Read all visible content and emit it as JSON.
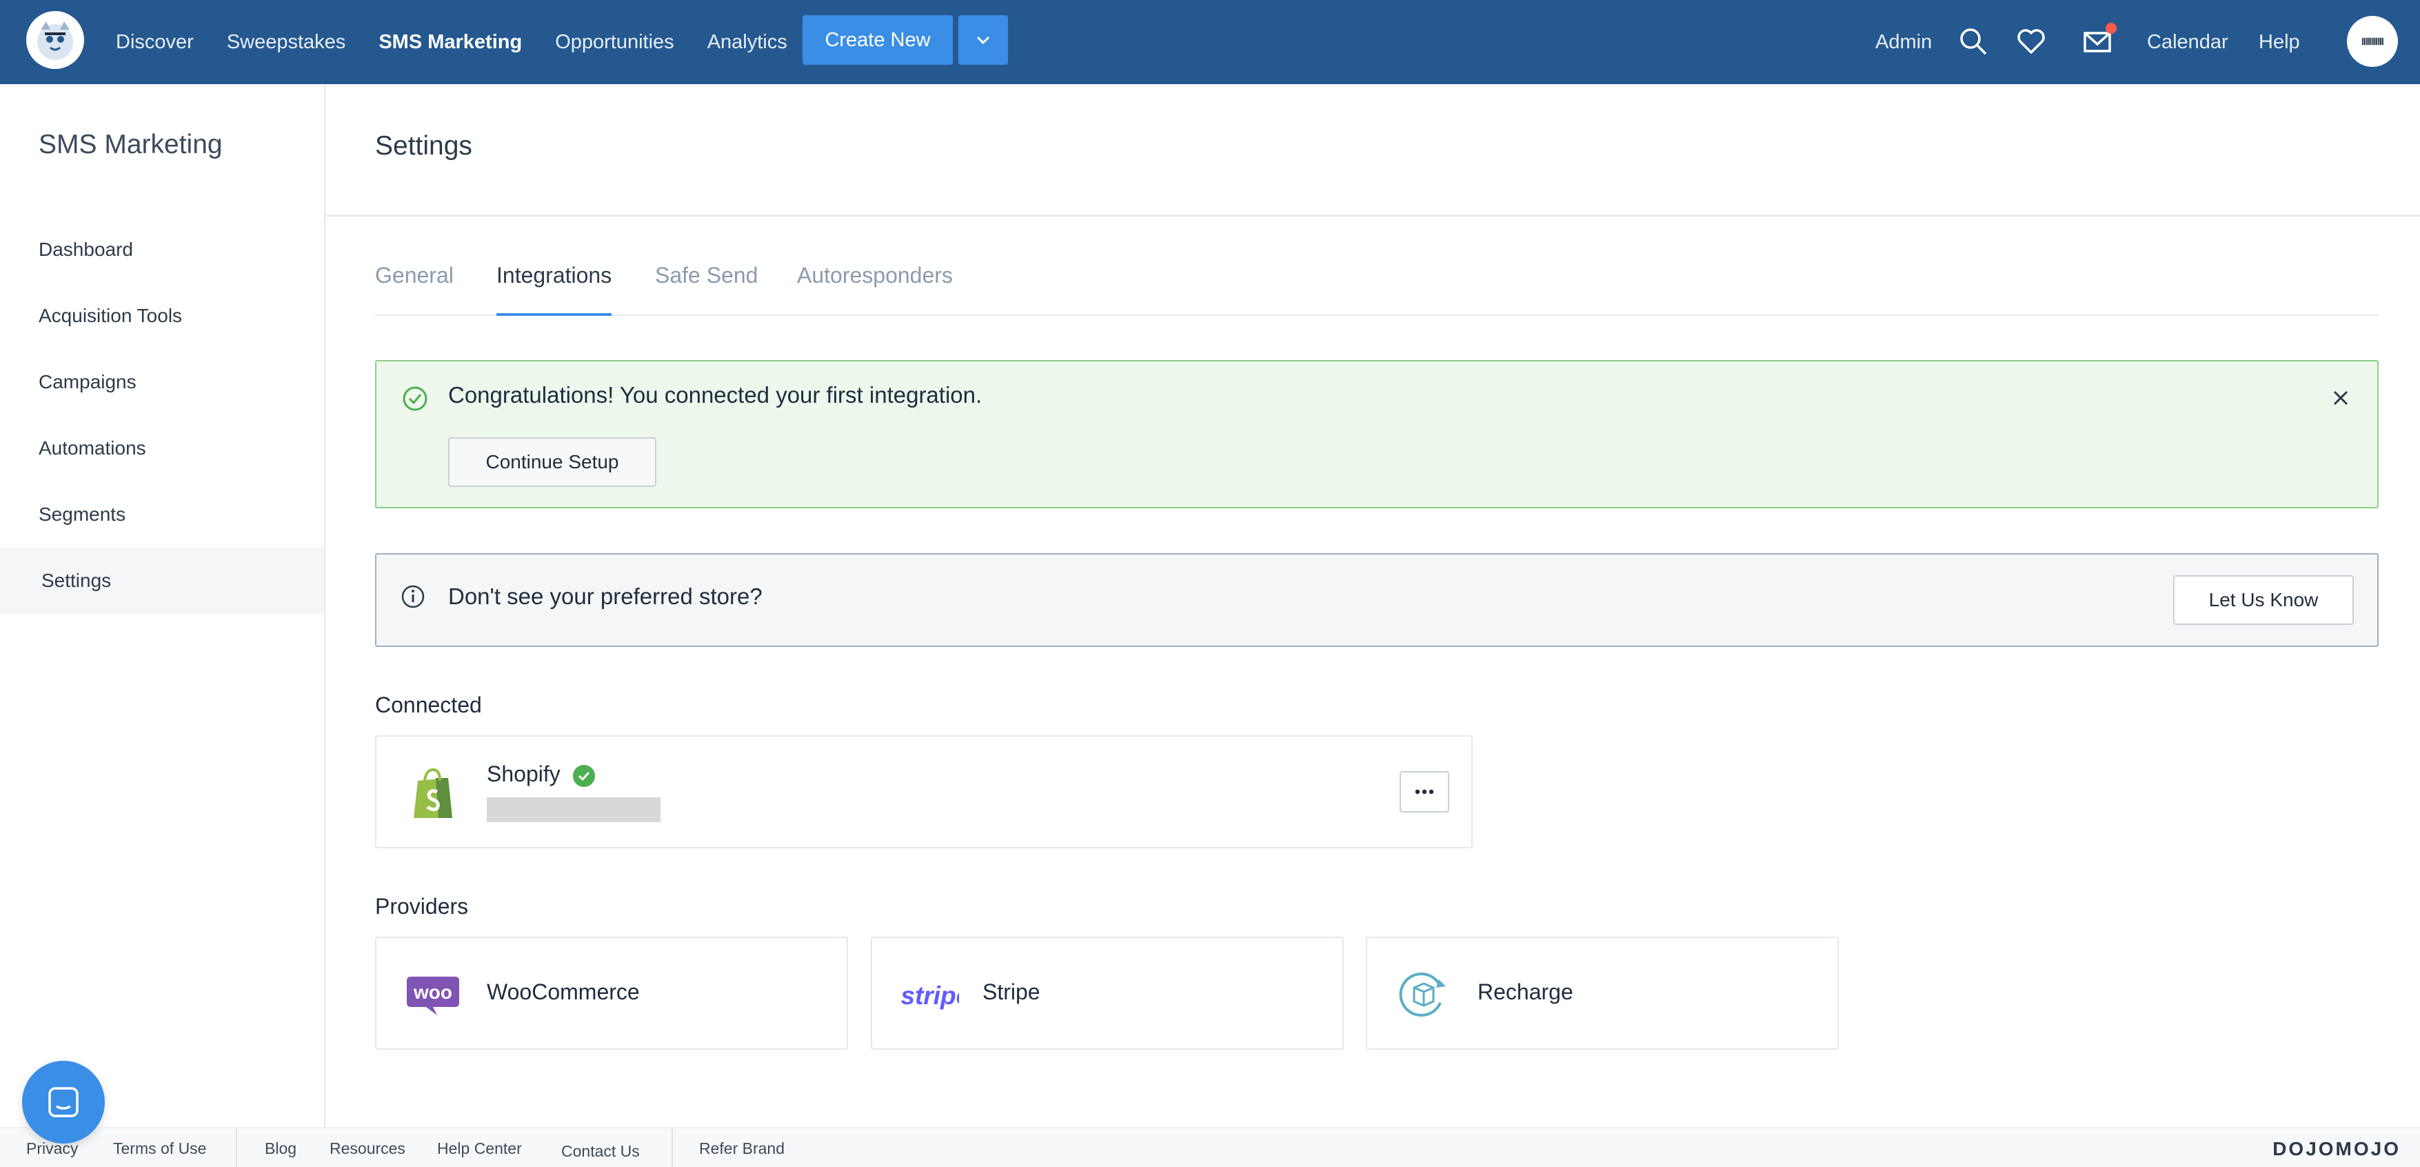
{
  "nav": {
    "links": [
      "Discover",
      "Sweepstakes",
      "SMS Marketing",
      "Opportunities",
      "Analytics"
    ],
    "active_link": "SMS Marketing",
    "create_label": "Create New",
    "admin_label": "Admin",
    "calendar_label": "Calendar",
    "help_label": "Help",
    "avatar_text": "ⅡⅢⅢⅢ"
  },
  "sidebar": {
    "title": "SMS Marketing",
    "items": [
      "Dashboard",
      "Acquisition Tools",
      "Campaigns",
      "Automations",
      "Segments",
      "Settings"
    ],
    "active_item": "Settings"
  },
  "page": {
    "title": "Settings",
    "tabs": [
      "General",
      "Integrations",
      "Safe Send",
      "Autoresponders"
    ],
    "active_tab": "Integrations"
  },
  "success_banner": {
    "message": "Congratulations! You connected your first integration.",
    "button_label": "Continue Setup"
  },
  "info_banner": {
    "message": "Don't see your preferred store?",
    "button_label": "Let Us Know"
  },
  "connected": {
    "heading": "Connected",
    "items": [
      {
        "name": "Shopify",
        "status": "connected"
      }
    ]
  },
  "providers": {
    "heading": "Providers",
    "items": [
      {
        "name": "WooCommerce",
        "icon": "woocommerce-logo"
      },
      {
        "name": "Stripe",
        "icon": "stripe-logo"
      },
      {
        "name": "Recharge",
        "icon": "recharge-logo"
      }
    ]
  },
  "footer": {
    "links": [
      "Privacy",
      "Terms of Use",
      "Blog",
      "Resources",
      "Help Center",
      "Contact Us",
      "Refer Brand"
    ],
    "brand": "DOJOMOJO"
  },
  "colors": {
    "nav_bg": "#24588f",
    "accent": "#3a8ee6",
    "success_bg": "#edf7ec",
    "success_border": "#8ccf88",
    "success_icon": "#4caf50",
    "notification": "#ff5a4a"
  }
}
